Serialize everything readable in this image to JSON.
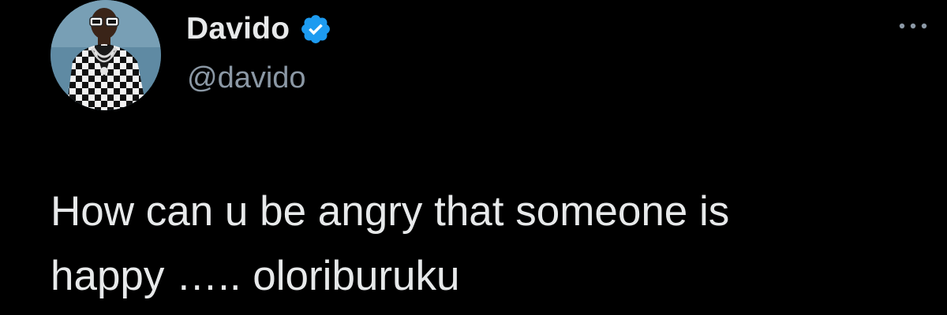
{
  "tweet": {
    "author": {
      "display_name": "Davido",
      "handle": "@davido",
      "verified": true,
      "avatar_icon": "profile-photo"
    },
    "more_icon": "more-dots-icon",
    "text": "How can u be angry that someone is\nhappy ….. oloriburuku"
  },
  "colors": {
    "background": "#000000",
    "primary_text": "#e7e9ea",
    "secondary_text": "#8b98a5",
    "verified_blue": "#1d9bf0"
  }
}
